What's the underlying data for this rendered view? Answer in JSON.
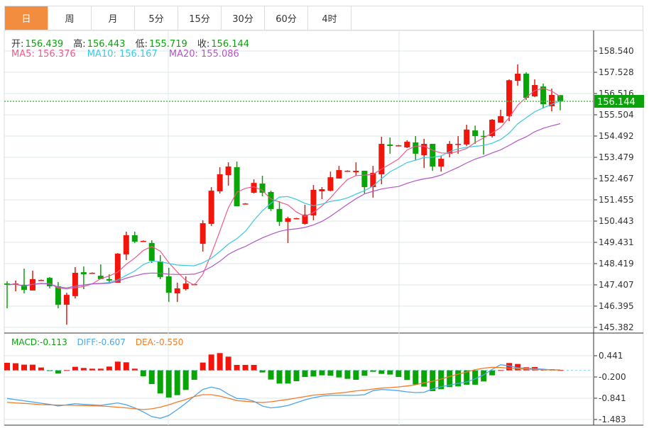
{
  "tabs": [
    {
      "label": "日",
      "active": true
    },
    {
      "label": "周"
    },
    {
      "label": "月"
    },
    {
      "label": "5分"
    },
    {
      "label": "15分"
    },
    {
      "label": "30分"
    },
    {
      "label": "60分"
    },
    {
      "label": "4时"
    }
  ],
  "ohlc_info": {
    "open_label": "开:",
    "open": "156.439",
    "high_label": "高:",
    "high": "156.443",
    "low_label": "低:",
    "low": "155.719",
    "close_label": "收:",
    "close": "156.144"
  },
  "ma_info": {
    "ma5": "MA5: 156.376",
    "ma10": "MA10: 156.167",
    "ma20": "MA20: 155.086"
  },
  "macd_info": {
    "macd": "MACD:-0.113",
    "diff": "DIFF:-0.607",
    "dea": "DEA:-0.550"
  },
  "current_price": "156.144",
  "colors": {
    "up": "#f2150b",
    "down": "#08a408",
    "ma5": "#ee5a8a",
    "ma10": "#3cc8e0",
    "ma20": "#b455c8",
    "diff": "#4aa6ef",
    "dea": "#f57b25",
    "active_tab": "#f28c3f",
    "price_tag": "#0aa30a"
  },
  "chart_data": [
    {
      "type": "candlestick",
      "ylim": [
        145.382,
        158.54
      ],
      "yticks": [
        "158.540",
        "157.528",
        "156.516",
        "155.504",
        "154.492",
        "153.479",
        "152.467",
        "151.455",
        "150.443",
        "149.431",
        "148.419",
        "147.407",
        "146.395",
        "145.382"
      ],
      "grid": true,
      "candles_ohlc": [
        [
          147.47,
          147.58,
          146.29,
          147.41
        ],
        [
          147.41,
          147.61,
          147.1,
          147.47
        ],
        [
          147.41,
          148.18,
          147.0,
          147.17
        ],
        [
          147.14,
          148.08,
          147.14,
          147.68
        ],
        [
          147.64,
          147.66,
          147.62,
          147.64
        ],
        [
          147.74,
          147.78,
          147.24,
          147.34
        ],
        [
          147.34,
          147.54,
          146.29,
          146.46
        ],
        [
          146.46,
          147.03,
          145.51,
          146.93
        ],
        [
          146.87,
          148.25,
          146.76,
          147.98
        ],
        [
          148.01,
          148.28,
          147.2,
          147.91
        ],
        [
          147.98,
          148.0,
          147.96,
          147.98
        ],
        [
          147.84,
          148.38,
          147.68,
          147.68
        ],
        [
          147.68,
          147.91,
          147.47,
          147.61
        ],
        [
          147.51,
          148.92,
          147.51,
          148.89
        ],
        [
          148.86,
          149.94,
          148.59,
          149.77
        ],
        [
          149.77,
          149.94,
          149.4,
          149.46
        ],
        [
          149.5,
          149.52,
          149.48,
          149.5
        ],
        [
          149.4,
          149.53,
          148.45,
          148.55
        ],
        [
          148.52,
          148.82,
          147.68,
          147.78
        ],
        [
          147.81,
          148.22,
          146.59,
          147.03
        ],
        [
          147.0,
          147.51,
          146.59,
          147.24
        ],
        [
          147.2,
          147.81,
          147.14,
          147.47
        ],
        [
          147.44,
          147.46,
          147.42,
          147.44
        ],
        [
          149.36,
          150.48,
          148.99,
          150.34
        ],
        [
          150.31,
          152.06,
          150.21,
          151.89
        ],
        [
          151.86,
          153.01,
          151.76,
          152.67
        ],
        [
          152.63,
          153.24,
          152.13,
          153.04
        ],
        [
          153.01,
          153.28,
          151.15,
          151.15
        ],
        [
          151.28,
          151.3,
          151.26,
          151.28
        ],
        [
          151.79,
          152.43,
          151.76,
          152.26
        ],
        [
          152.23,
          152.6,
          151.62,
          151.79
        ],
        [
          151.83,
          151.89,
          150.92,
          151.02
        ],
        [
          151.02,
          151.39,
          150.21,
          150.41
        ],
        [
          150.41,
          150.65,
          149.4,
          150.58
        ],
        [
          150.58,
          150.6,
          150.56,
          150.58
        ],
        [
          150.31,
          151.22,
          150.27,
          150.75
        ],
        [
          150.71,
          152.16,
          150.48,
          151.93
        ],
        [
          151.86,
          152.06,
          151.49,
          151.96
        ],
        [
          151.89,
          152.8,
          151.86,
          152.53
        ],
        [
          152.47,
          153.07,
          152.47,
          152.87
        ],
        [
          152.84,
          152.86,
          152.82,
          152.84
        ],
        [
          152.77,
          153.24,
          152.6,
          152.84
        ],
        [
          152.84,
          152.84,
          151.76,
          152.06
        ],
        [
          152.06,
          153.07,
          151.56,
          152.74
        ],
        [
          152.67,
          154.46,
          152.2,
          154.12
        ],
        [
          154.09,
          154.42,
          153.65,
          154.02
        ],
        [
          154.05,
          154.07,
          154.03,
          154.05
        ],
        [
          153.95,
          154.29,
          153.92,
          154.22
        ],
        [
          154.19,
          154.49,
          153.34,
          153.65
        ],
        [
          153.58,
          154.36,
          152.97,
          154.12
        ],
        [
          154.12,
          154.12,
          152.84,
          153.04
        ],
        [
          153.04,
          153.55,
          152.8,
          153.41
        ],
        [
          153.65,
          154.25,
          153.48,
          154.12
        ],
        [
          154.09,
          154.49,
          153.65,
          154.12
        ],
        [
          154.09,
          155.03,
          154.02,
          154.8
        ],
        [
          154.76,
          154.99,
          154.12,
          154.49
        ],
        [
          154.5,
          154.76,
          153.61,
          154.49
        ],
        [
          154.49,
          155.3,
          154.42,
          155.27
        ],
        [
          155.13,
          155.74,
          155.13,
          155.44
        ],
        [
          155.44,
          157.19,
          155.2,
          157.15
        ],
        [
          157.12,
          157.9,
          156.89,
          157.46
        ],
        [
          157.46,
          157.53,
          156.21,
          156.31
        ],
        [
          156.38,
          157.19,
          156.35,
          156.92
        ],
        [
          156.85,
          156.99,
          155.8,
          156.01
        ],
        [
          155.91,
          156.75,
          155.67,
          156.45
        ],
        [
          156.439,
          156.443,
          155.719,
          156.144
        ]
      ],
      "moving_averages": [
        "MA5",
        "MA10",
        "MA20"
      ]
    },
    {
      "type": "macd",
      "ylim": [
        -1.483,
        0.441
      ],
      "yticks": [
        "0.441",
        "-0.200",
        "-0.841",
        "-1.483"
      ],
      "macd_hist": [
        0.228,
        0.214,
        0.171,
        0.171,
        0.085,
        -0.02,
        -0.093,
        0.005,
        0.107,
        0.071,
        0.05,
        0.05,
        0.114,
        0.263,
        0.242,
        0.05,
        -0.178,
        -0.413,
        -0.698,
        -0.819,
        -0.748,
        -0.591,
        -0.285,
        0.235,
        0.477,
        0.52,
        0.413,
        0.164,
        0.164,
        0.164,
        -0.064,
        -0.278,
        -0.399,
        -0.399,
        -0.328,
        -0.199,
        -0.185,
        -0.15,
        -0.164,
        -0.214,
        -0.256,
        -0.285,
        -0.164,
        -0.043,
        -0.107,
        -0.128,
        -0.199,
        -0.292,
        -0.427,
        -0.491,
        -0.627,
        -0.57,
        -0.506,
        -0.484,
        -0.434,
        -0.434,
        -0.335,
        -0.15,
        0.005,
        0.221,
        0.192,
        0.093,
        0.1,
        0.021,
        0.035,
        0.01
      ],
      "diff": [
        -0.848,
        -0.884,
        -0.919,
        -0.955,
        -0.991,
        -1.026,
        -1.076,
        -1.04,
        -1.005,
        -1.026,
        -1.04,
        -1.055,
        -1.019,
        -0.983,
        -1.04,
        -1.133,
        -1.254,
        -1.396,
        -1.446,
        -1.361,
        -1.183,
        -0.991,
        -0.777,
        -0.577,
        -0.506,
        -0.563,
        -0.72,
        -0.848,
        -0.862,
        -0.934,
        -1.076,
        -1.133,
        -1.104,
        -1.062,
        -0.976,
        -0.891,
        -0.827,
        -0.777,
        -0.755,
        -0.755,
        -0.755,
        -0.755,
        -0.734,
        -0.613,
        -0.577,
        -0.592,
        -0.613,
        -0.649,
        -0.67,
        -0.663,
        -0.563,
        -0.492,
        -0.449,
        -0.392,
        -0.35,
        -0.257,
        -0.136,
        0.028,
        0.17,
        0.135,
        0.078,
        0.064,
        0.049,
        0.035,
        0.014,
        0.014
      ],
      "dea": [
        -0.962,
        -0.983,
        -0.998,
        -1.012,
        -1.033,
        -1.04,
        -1.048,
        -1.048,
        -1.055,
        -1.062,
        -1.069,
        -1.076,
        -1.09,
        -1.112,
        -1.133,
        -1.161,
        -1.183,
        -1.161,
        -1.112,
        -1.04,
        -0.955,
        -0.877,
        -0.791,
        -0.734,
        -0.734,
        -0.777,
        -0.841,
        -0.912,
        -0.934,
        -0.955,
        -0.969,
        -0.948,
        -0.912,
        -0.877,
        -0.834,
        -0.791,
        -0.748,
        -0.727,
        -0.706,
        -0.684,
        -0.656,
        -0.62,
        -0.599,
        -0.563,
        -0.535,
        -0.52,
        -0.499,
        -0.471,
        -0.435,
        -0.378,
        -0.328,
        -0.264,
        -0.186,
        -0.115,
        -0.05,
        0.021,
        0.064,
        0.092,
        0.085,
        0.064,
        0.049,
        0.035,
        0.028,
        0.021,
        0.014,
        0.014
      ]
    }
  ]
}
